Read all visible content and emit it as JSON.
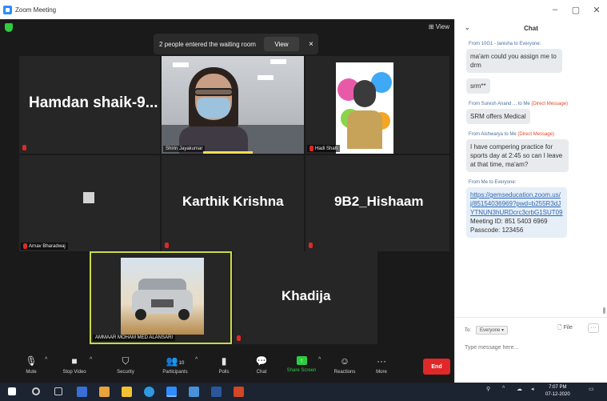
{
  "window": {
    "title": "Zoom Meeting",
    "controls": [
      "–",
      "▢",
      "✕"
    ]
  },
  "meeting": {
    "view_label": "⊞ View",
    "waiting_room": {
      "text": "2 people entered the waiting room",
      "view_label": "View",
      "close": "×"
    },
    "tiles": {
      "hamdan": {
        "name": "Hamdan  shaik-9..."
      },
      "shirin": {
        "label": "Shirin Jayakumar"
      },
      "hadi": {
        "label": "Hadi Shah"
      },
      "arnav": {
        "label": "Arnav Bharadwaj"
      },
      "karthik": {
        "name": "Karthik Krishna"
      },
      "hishaam": {
        "name": "9B2_Hishaam"
      },
      "ammaar": {
        "label": "AMMAAR MOHAM MED ALANSARI"
      },
      "khadija": {
        "name": "Khadija"
      }
    }
  },
  "toolbar": {
    "items": [
      {
        "label": "Mute",
        "glyph": "🎙"
      },
      {
        "label": "Stop Video",
        "glyph": "■"
      },
      {
        "label": "Security",
        "glyph": "⛉"
      },
      {
        "label": "Participants",
        "glyph": "👥",
        "count": "10"
      },
      {
        "label": "Polls",
        "glyph": "▮"
      },
      {
        "label": "Chat",
        "glyph": "💬"
      },
      {
        "label": "Share Screen",
        "glyph": "↑"
      },
      {
        "label": "Reactions",
        "glyph": "☺"
      },
      {
        "label": "More",
        "glyph": "···"
      }
    ],
    "end_label": "End"
  },
  "chat": {
    "title": "Chat",
    "collapse": "⌄",
    "messages": [
      {
        "from": "From 10G1 - tanisha to Everyone:",
        "text": "ma'am could you assign me to drm"
      },
      {
        "text": "srm**"
      },
      {
        "from_name": "From Suresh Anand ... to Me",
        "dm": "(Direct Message)",
        "text": "SRM offers Medical"
      },
      {
        "from_name": "From Aishwarya to Me",
        "dm": "(Direct Message)",
        "text": "I have compering practice for sports day at 2:45 so can I leave at that time, ma'am?"
      },
      {
        "from": "From Me to Everyone:",
        "link": "https://gemseducation.zoom.us/j/85154036969?pwd=b255R3dJYTNUN3hURDcrc3crbG1SUT09",
        "meeting_id": "Meeting ID: 851 5403 6969",
        "passcode": "Passcode: 123456"
      }
    ],
    "to_label": "To:",
    "to_value": "Everyone ▾",
    "file_label": "File",
    "more_label": "···",
    "placeholder": "Type message here..."
  },
  "taskbar": {
    "time": "7:07 PM",
    "date": "07-12-2020"
  },
  "colors": {
    "accent": "#2d8cff",
    "share_green": "#2ecc40",
    "end_red": "#e02828",
    "active_speaker": "#f4e04d"
  }
}
